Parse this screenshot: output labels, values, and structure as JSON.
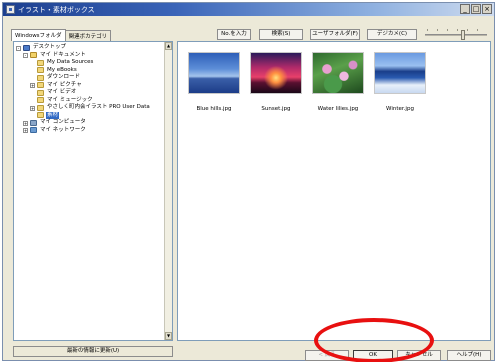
{
  "window": {
    "title": "イラスト・素材ボックス",
    "controls": [
      "_",
      "□",
      "×"
    ]
  },
  "left_panel": {
    "tabs": [
      {
        "label": "Windowsフォルダ",
        "active": true
      },
      {
        "label": "関連ボカテゴリ",
        "active": false
      }
    ],
    "tree": [
      {
        "label": "デスクトップ",
        "level": 0,
        "icon": "desktop-icon",
        "expander": "-",
        "selected": false
      },
      {
        "label": "マイ ドキュメント",
        "level": 1,
        "icon": "documents-icon",
        "expander": "-",
        "selected": false
      },
      {
        "label": "My Data Sources",
        "level": 2,
        "icon": "folder-icon",
        "expander": "",
        "selected": false
      },
      {
        "label": "My eBooks",
        "level": 2,
        "icon": "folder-icon",
        "expander": "",
        "selected": false
      },
      {
        "label": "ダウンロード",
        "level": 2,
        "icon": "folder-icon",
        "expander": "",
        "selected": false
      },
      {
        "label": "マイ ピクチャ",
        "level": 2,
        "icon": "folder-icon",
        "expander": "+",
        "selected": false
      },
      {
        "label": "マイ ビデオ",
        "level": 2,
        "icon": "folder-icon",
        "expander": "",
        "selected": false
      },
      {
        "label": "マイ ミュージック",
        "level": 2,
        "icon": "folder-icon",
        "expander": "",
        "selected": false
      },
      {
        "label": "やさしく町内会イラスト PRO User Data",
        "level": 2,
        "icon": "folder-icon",
        "expander": "+",
        "selected": false
      },
      {
        "label": "素材",
        "level": 2,
        "icon": "folder-icon",
        "expander": "",
        "selected": true
      },
      {
        "label": "マイ コンピュータ",
        "level": 1,
        "icon": "computer-icon",
        "expander": "+",
        "selected": false
      },
      {
        "label": "マイ ネットワーク",
        "level": 1,
        "icon": "network-icon",
        "expander": "+",
        "selected": false
      }
    ],
    "update_button": "最新の情報に更新(U)"
  },
  "toolbar": {
    "name_input": "No.を入力",
    "search": "検索(S)",
    "user_folder": "ユーザフォルダ(F)",
    "digital_camera": "デジカメ(C)"
  },
  "thumbnails": [
    {
      "caption": "Blue hills.jpg",
      "image": "img-bluehills"
    },
    {
      "caption": "Sunset.jpg",
      "image": "img-sunset"
    },
    {
      "caption": "Water lilies.jpg",
      "image": "img-water"
    },
    {
      "caption": "Winter.jpg",
      "image": "img-winter"
    }
  ],
  "bottom_buttons": {
    "back": "< 戻る",
    "ok": "OK",
    "cancel": "キャンセル",
    "help": "ヘルプ(H)"
  },
  "colors": {
    "highlight_ring": "#e81010",
    "selection": "#316ac5"
  }
}
